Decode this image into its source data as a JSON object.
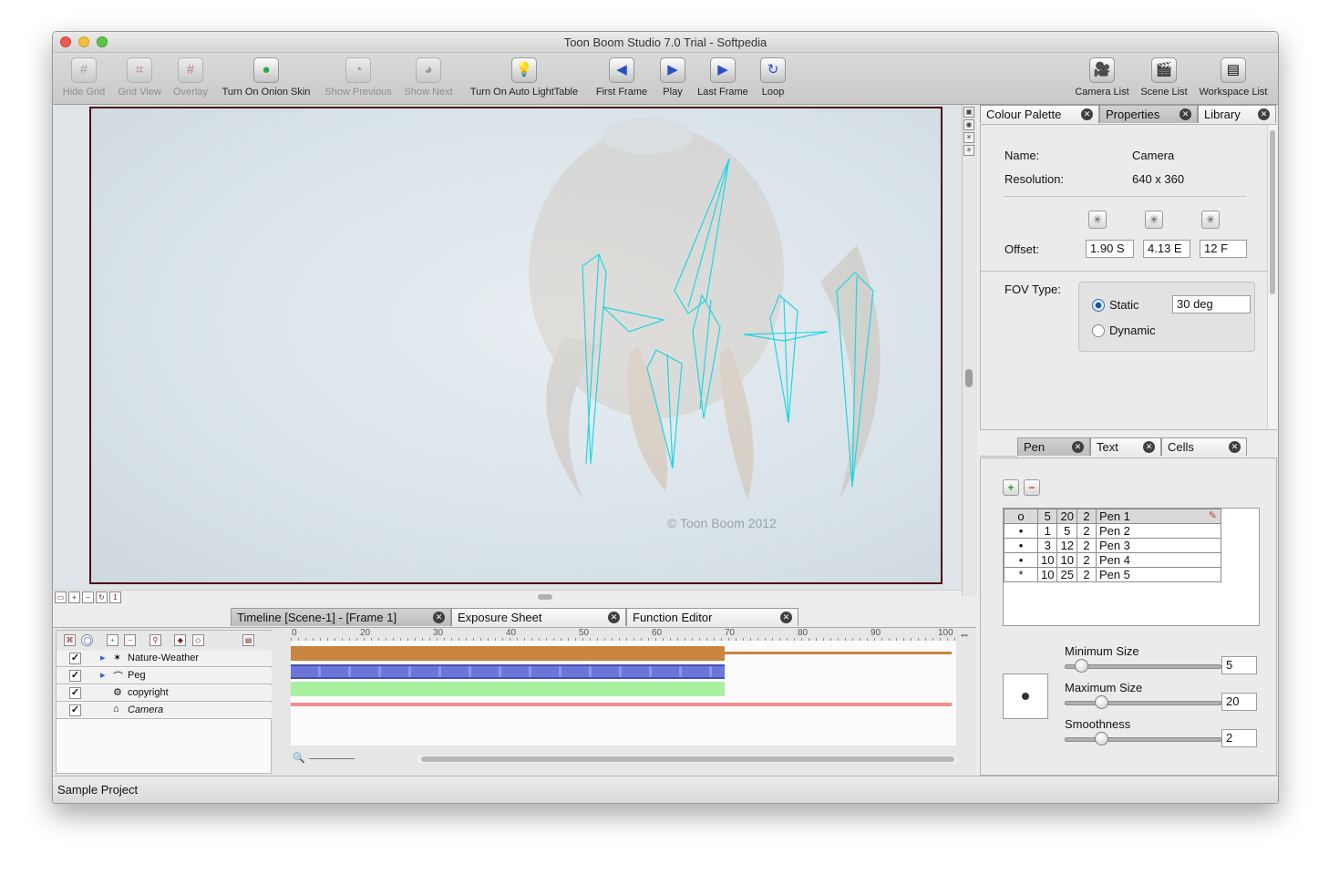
{
  "window": {
    "title": "Toon Boom Studio 7.0 Trial - Softpedia"
  },
  "toolbar": {
    "items": [
      {
        "label": "Hide Grid",
        "icon": "grid-icon",
        "glyph": "#"
      },
      {
        "label": "Grid View",
        "icon": "grid-view-icon",
        "glyph": "⌗"
      },
      {
        "label": "Overlay",
        "icon": "overlay-icon",
        "glyph": "#"
      },
      {
        "label": "Turn On Onion Skin",
        "icon": "onion-skin-icon",
        "glyph": "●"
      },
      {
        "label": "Show Previous",
        "icon": "show-previous-icon",
        "glyph": "◔"
      },
      {
        "label": "Show Next",
        "icon": "show-next-icon",
        "glyph": "◕"
      },
      {
        "label": "Turn On Auto LightTable",
        "icon": "lightbulb-icon",
        "glyph": "💡"
      },
      {
        "label": "First Frame",
        "icon": "first-frame-icon",
        "glyph": "◀"
      },
      {
        "label": "Play",
        "icon": "play-icon",
        "glyph": "▶"
      },
      {
        "label": "Last Frame",
        "icon": "last-frame-icon",
        "glyph": "▶"
      },
      {
        "label": "Loop",
        "icon": "loop-icon",
        "glyph": "↻"
      },
      {
        "label": "Camera List",
        "icon": "camera-list-icon",
        "glyph": "🎥"
      },
      {
        "label": "Scene List",
        "icon": "scene-list-icon",
        "glyph": "🎬"
      },
      {
        "label": "Workspace List",
        "icon": "workspace-list-icon",
        "glyph": "▤"
      }
    ]
  },
  "stage": {
    "watermark": "© Toon Boom 2012"
  },
  "right_tabs_top": [
    "Colour Palette",
    "Properties",
    "Library"
  ],
  "properties": {
    "name_label": "Name:",
    "name_value": "Camera",
    "resolution_label": "Resolution:",
    "resolution_value": "640 x 360",
    "offset_label": "Offset:",
    "offset_values": [
      "1.90 S",
      "4.13 E",
      "12 F"
    ],
    "fov_label": "FOV Type:",
    "static_label": "Static",
    "static_value": "30 deg",
    "dynamic_label": "Dynamic"
  },
  "right_tabs_bottom": [
    "Pen",
    "Text",
    "Cells"
  ],
  "pens": {
    "rows": [
      {
        "dot": "o",
        "min": "5",
        "max": "20",
        "smooth": "2",
        "name": "Pen 1"
      },
      {
        "dot": "•",
        "min": "1",
        "max": "5",
        "smooth": "2",
        "name": "Pen 2"
      },
      {
        "dot": "•",
        "min": "3",
        "max": "12",
        "smooth": "2",
        "name": "Pen 3"
      },
      {
        "dot": "•",
        "min": "10",
        "max": "10",
        "smooth": "2",
        "name": "Pen 4"
      },
      {
        "dot": "*",
        "min": "10",
        "max": "25",
        "smooth": "2",
        "name": "Pen 5"
      }
    ],
    "min_size_label": "Minimum Size",
    "min_size_value": "5",
    "max_size_label": "Maximum Size",
    "max_size_value": "20",
    "smoothness_label": "Smoothness",
    "smoothness_value": "2"
  },
  "timeline_tabs": [
    "Timeline [Scene-1] - [Frame 1]",
    "Exposure Sheet",
    "Function Editor"
  ],
  "timeline": {
    "ruler": [
      "0",
      "20",
      "30",
      "40",
      "50",
      "60",
      "70",
      "80",
      "90",
      "100"
    ],
    "layers": [
      {
        "name": "Nature-Weather",
        "icon": "nature-weather-icon"
      },
      {
        "name": "Peg",
        "icon": "peg-icon"
      },
      {
        "name": "copyright",
        "icon": "copyright-layer-icon"
      },
      {
        "name": "Camera",
        "icon": "camera-layer-icon"
      }
    ]
  },
  "status": {
    "text": "Sample Project"
  },
  "colors": {
    "layer_orange": "#c9843e",
    "layer_blue": "#7b83e0",
    "layer_green": "#a9f0a0",
    "layer_red": "#f28c8c",
    "rig_cyan": "#20d6e0"
  }
}
